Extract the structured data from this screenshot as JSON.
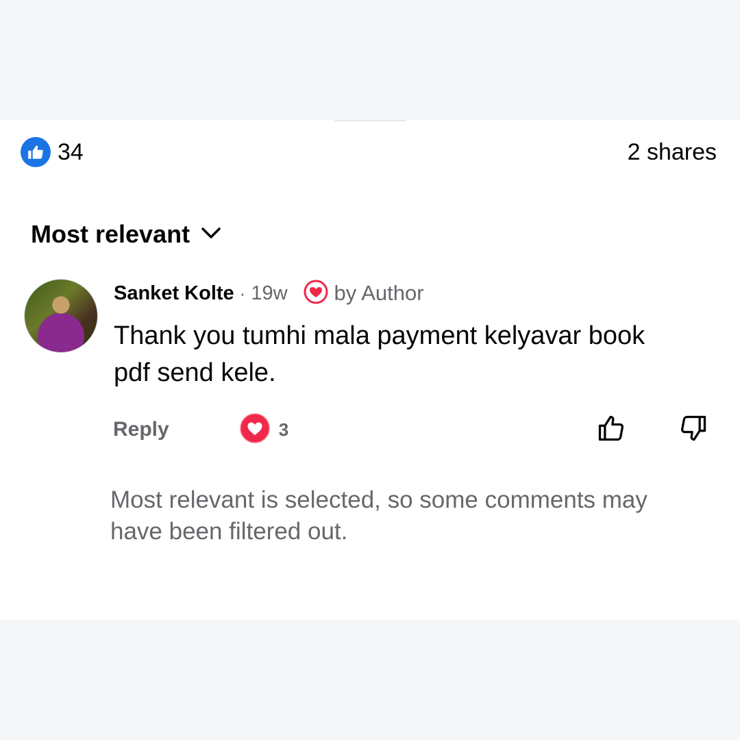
{
  "stats": {
    "like_count": "34",
    "shares": "2 shares"
  },
  "sort": {
    "label": "Most relevant"
  },
  "comment": {
    "author": "Sanket Kolte",
    "separator": "·",
    "time": "19w",
    "author_badge": "by Author",
    "text": "Thank you tumhi mala payment kelyavar book pdf send kele.",
    "reply_label": "Reply",
    "reaction_count": "3"
  },
  "filter_note": "Most relevant is selected, so some comments may have been filtered out.",
  "colors": {
    "brand_blue": "#1b74e4",
    "heart_red": "#f02849",
    "secondary_text": "#65676b"
  },
  "icons": {
    "like_badge": "thumbs-up-icon",
    "sort_toggle": "chevron-down-icon",
    "author_badge": "heart-outline-icon",
    "reaction": "heart-icon",
    "upvote": "thumbs-up-outline-icon",
    "downvote": "thumbs-down-outline-icon"
  }
}
